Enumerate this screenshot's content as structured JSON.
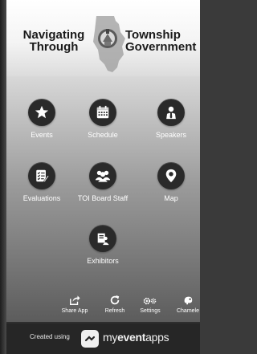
{
  "header": {
    "title_left_line1": "Navigating",
    "title_left_line2": "Through",
    "title_right_line1": "Township",
    "title_right_line2": "Government"
  },
  "tiles": [
    {
      "label": "Events",
      "icon": "star-icon"
    },
    {
      "label": "Schedule",
      "icon": "calendar-icon"
    },
    {
      "label": "Speakers",
      "icon": "speaker-person-icon"
    },
    {
      "label": "Evaluations",
      "icon": "checklist-icon"
    },
    {
      "label": "TOI Board Staff",
      "icon": "group-icon"
    },
    {
      "label": "Map",
      "icon": "map-pin-icon"
    },
    {
      "label": "Exhibitors",
      "icon": "exhibitor-icon"
    }
  ],
  "bottom_bar": [
    {
      "label": "Share App",
      "icon": "share-icon"
    },
    {
      "label": "Refresh",
      "icon": "refresh-icon"
    },
    {
      "label": "Settings",
      "icon": "settings-icon"
    },
    {
      "label": "Chamele",
      "icon": "chameleon-icon"
    }
  ],
  "footer": {
    "created_label": "Created using",
    "brand_light": "my",
    "brand_bold": "event",
    "brand_tail": "apps"
  },
  "colors": {
    "tile_circle": "#2a2a2a",
    "footer_bg": "#262626",
    "label_text": "#ffffff"
  }
}
